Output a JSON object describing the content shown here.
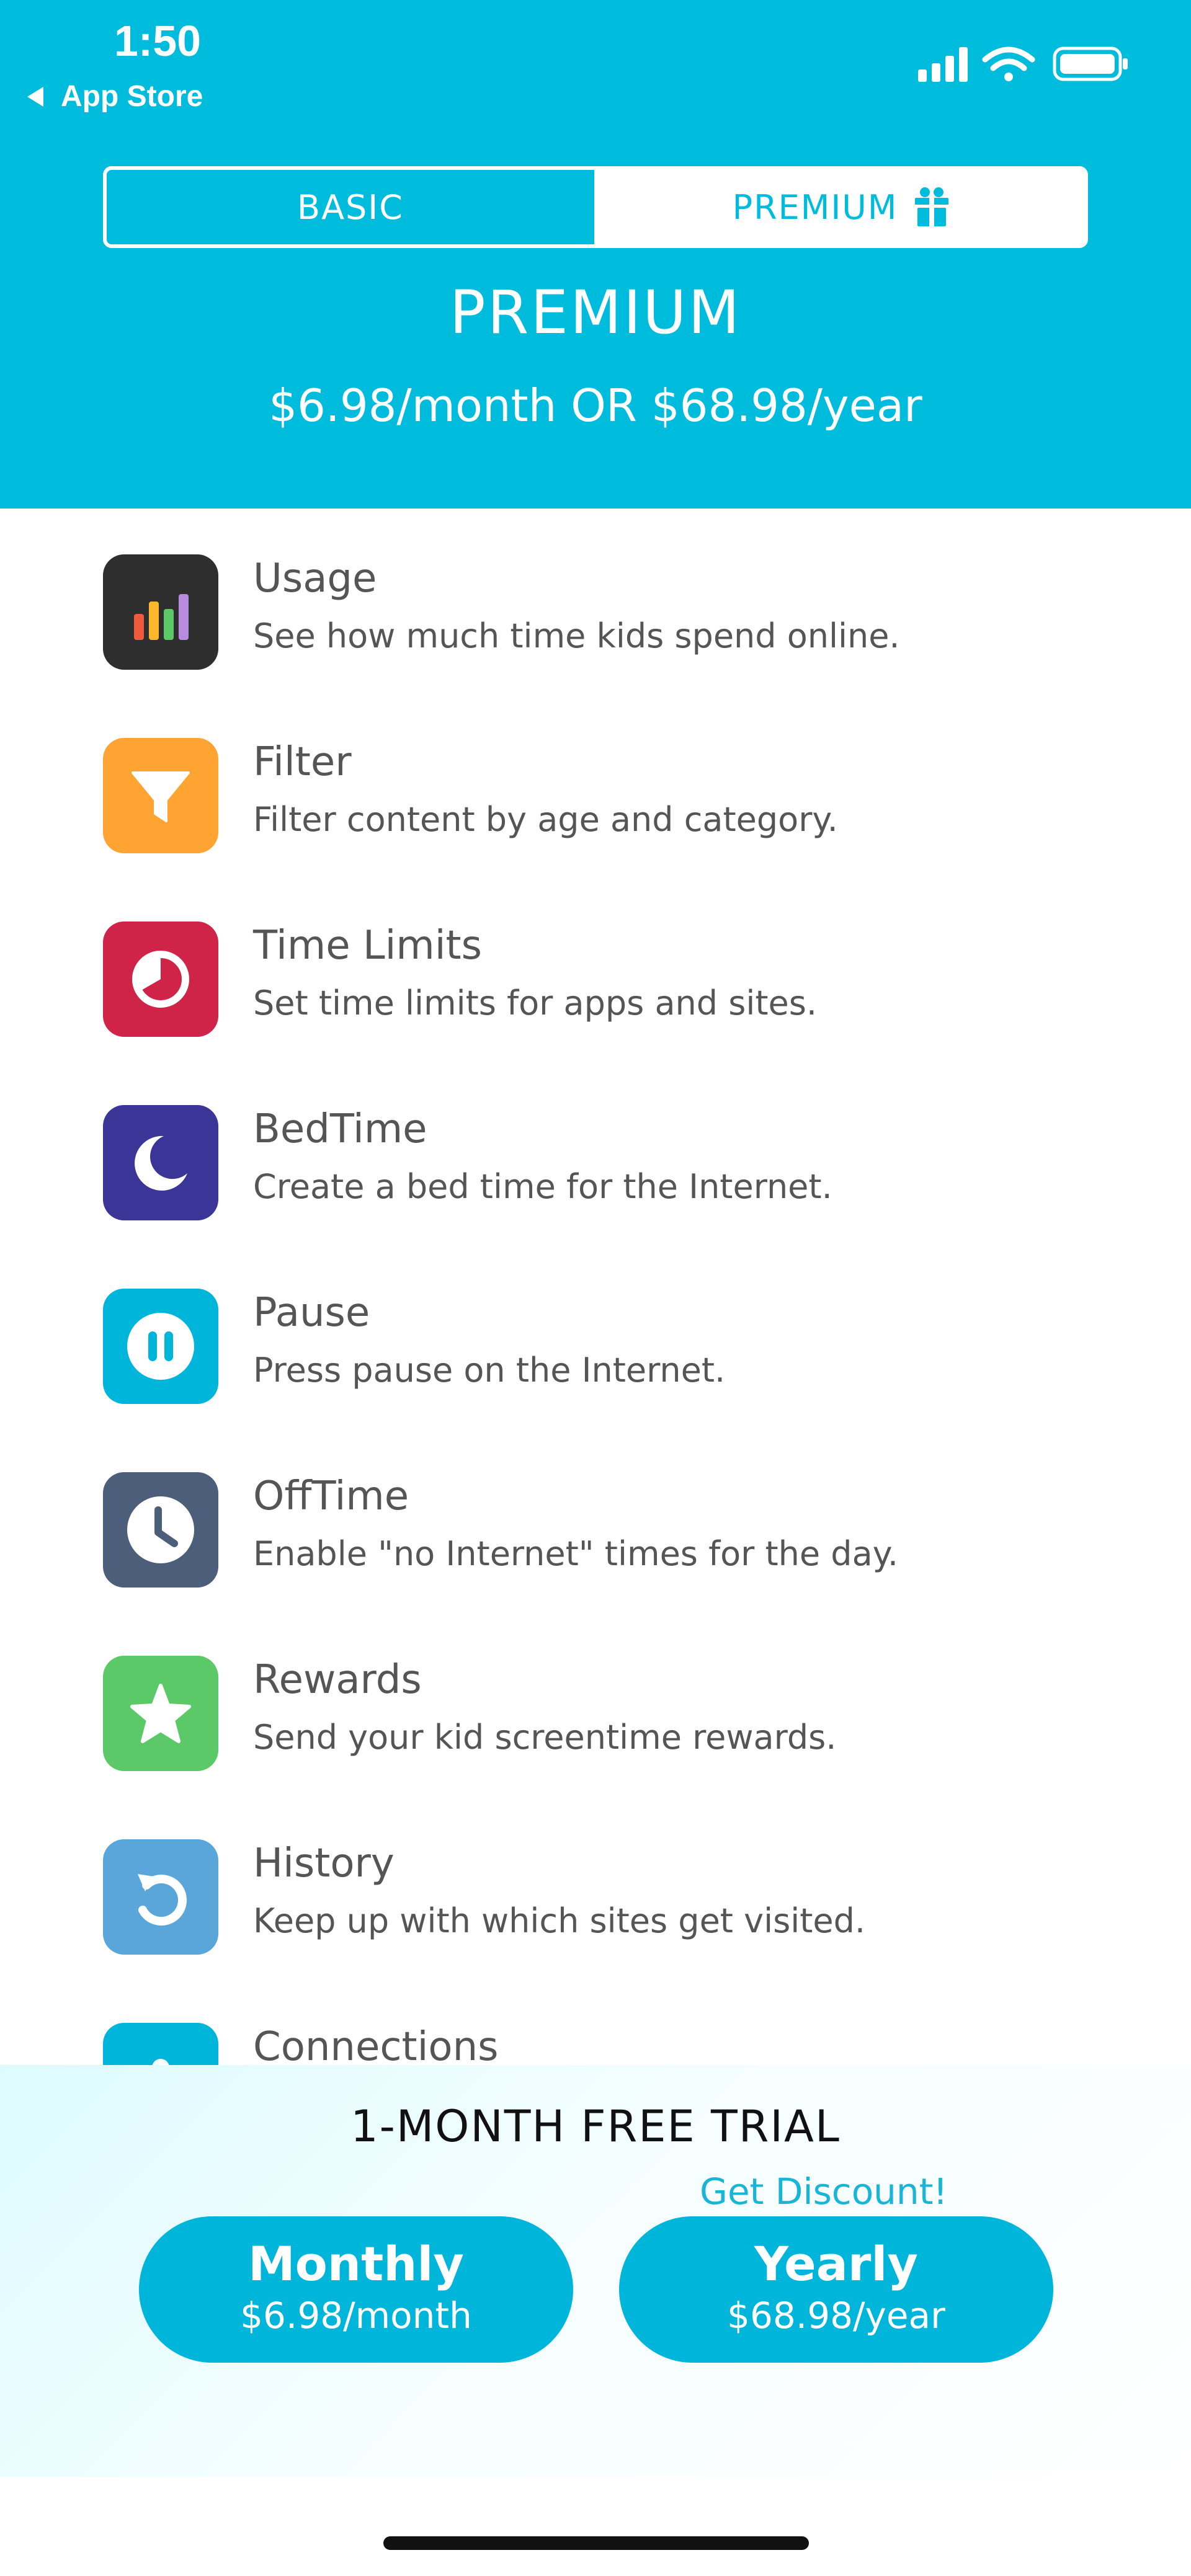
{
  "status_bar": {
    "time": "1:50",
    "back_label": "App Store"
  },
  "tabs": {
    "basic": "BASIC",
    "premium": "PREMIUM"
  },
  "plan": {
    "title": "PREMIUM",
    "price": "$6.98/month OR $68.98/year"
  },
  "features": [
    {
      "title": "Usage",
      "desc": "See how much time kids spend online.",
      "icon": "bar-chart-icon",
      "color": "#2E2E2E"
    },
    {
      "title": "Filter",
      "desc": "Filter content by age and category.",
      "icon": "funnel-icon",
      "color": "#FFA432"
    },
    {
      "title": "Time Limits",
      "desc": "Set time limits for apps and sites.",
      "icon": "timer-icon",
      "color": "#CF2448"
    },
    {
      "title": "BedTime",
      "desc": "Create a bed time for the Internet.",
      "icon": "moon-icon",
      "color": "#3A3596"
    },
    {
      "title": "Pause",
      "desc": "Press pause on the Internet.",
      "icon": "pause-icon",
      "color": "#00B5DA"
    },
    {
      "title": "OffTime",
      "desc": "Enable \"no Internet\" times for the day.",
      "icon": "clock-icon",
      "color": "#4D5E7A"
    },
    {
      "title": "Rewards",
      "desc": "Send your kid screentime rewards.",
      "icon": "star-icon",
      "color": "#5CC969"
    },
    {
      "title": "History",
      "desc": "Keep up with which sites get visited.",
      "icon": "history-icon",
      "color": "#5AA5DA"
    },
    {
      "title": "Connections",
      "desc": "",
      "icon": "connections-icon",
      "color": "#00B5DA"
    }
  ],
  "trial": {
    "title": "1-MONTH FREE TRIAL",
    "discount": "Get Discount!",
    "monthly": {
      "name": "Monthly",
      "price": "$6.98/month"
    },
    "yearly": {
      "name": "Yearly",
      "price": "$68.98/year"
    }
  },
  "colors": {
    "brand": "#00BCDC",
    "button": "#00B5DA",
    "text": "#555555"
  }
}
